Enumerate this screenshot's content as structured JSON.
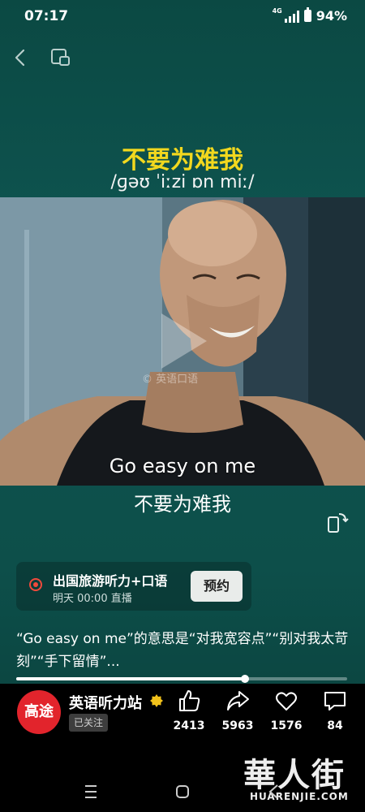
{
  "status_bar": {
    "time": "07:17",
    "network": "4G",
    "battery": "94%"
  },
  "topbar": {
    "back_icon": "chevron-left-icon",
    "window_icon": "floating-window-icon"
  },
  "lesson": {
    "title_cn": "不要为难我",
    "phonetic": "/ɡəʊ ˈiːzi ɒn miː/"
  },
  "video": {
    "watermark": "© 英语口语",
    "subtitle_en": "Go easy on me",
    "subtitle_cn": "不要为难我",
    "play_icon": "play-icon",
    "rotate_icon": "rotate-screen-icon"
  },
  "live_card": {
    "title": "出国旅游听力+口语",
    "time": "明天 00:00 直播",
    "button": "预约"
  },
  "description": "“Go easy on me”的意思是“对我宽容点”“别对我太苛刻”“手下留情”...",
  "progress": {
    "value": 0.69
  },
  "channel": {
    "avatar_text": "高途",
    "name": "英语听力站",
    "followed": "已关注"
  },
  "actions": {
    "like": "2413",
    "share": "5963",
    "favorite": "1576",
    "comment": "84"
  },
  "site_watermark": {
    "brand": "華人街",
    "url": "HUARENJIE.COM"
  },
  "colors": {
    "accent_yellow": "#f2d81e",
    "live_red": "#f04a3c",
    "avatar_red": "#e2242c"
  }
}
